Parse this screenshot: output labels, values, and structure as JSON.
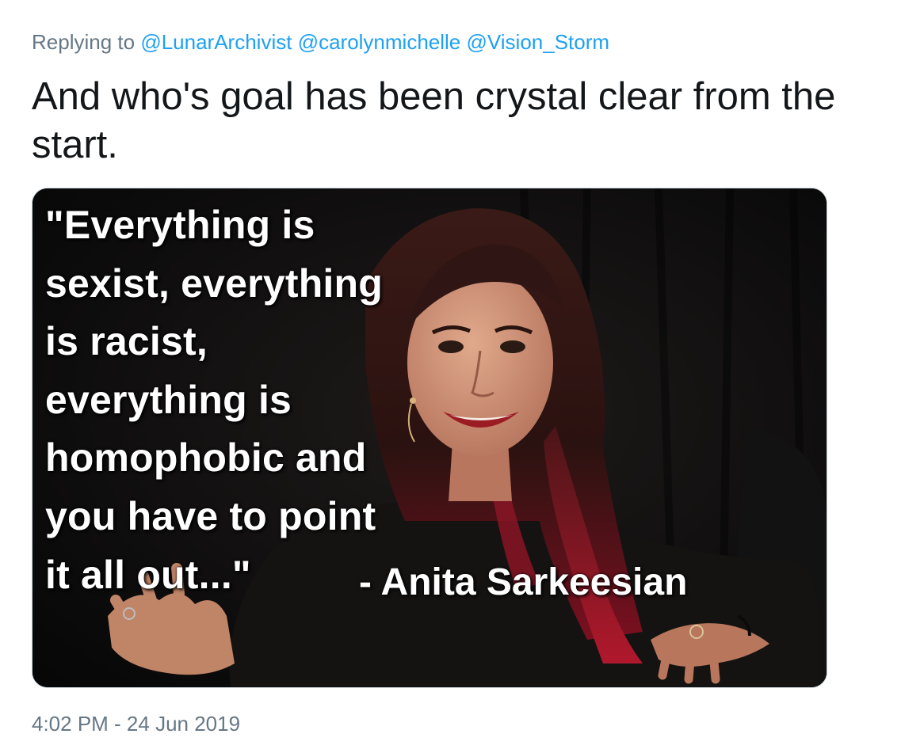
{
  "reply": {
    "prefix": "Replying to",
    "mentions": [
      "@LunarArchivist",
      "@carolynmichelle",
      "@Vision_Storm"
    ]
  },
  "tweet": {
    "text": "And who's goal has been crystal clear from the start."
  },
  "media": {
    "quote": "\"Everything is\nsexist, everything\nis racist,\neverything is\nhomophobic and\nyou have to point\nit all out...\"",
    "attribution": "- Anita Sarkeesian"
  },
  "meta": {
    "timestamp": "4:02 PM - 24 Jun 2019"
  },
  "colors": {
    "link": "#1da1f2",
    "secondary_text": "#657786",
    "primary_text": "#14171a",
    "card_border": "#ccd6dd"
  }
}
